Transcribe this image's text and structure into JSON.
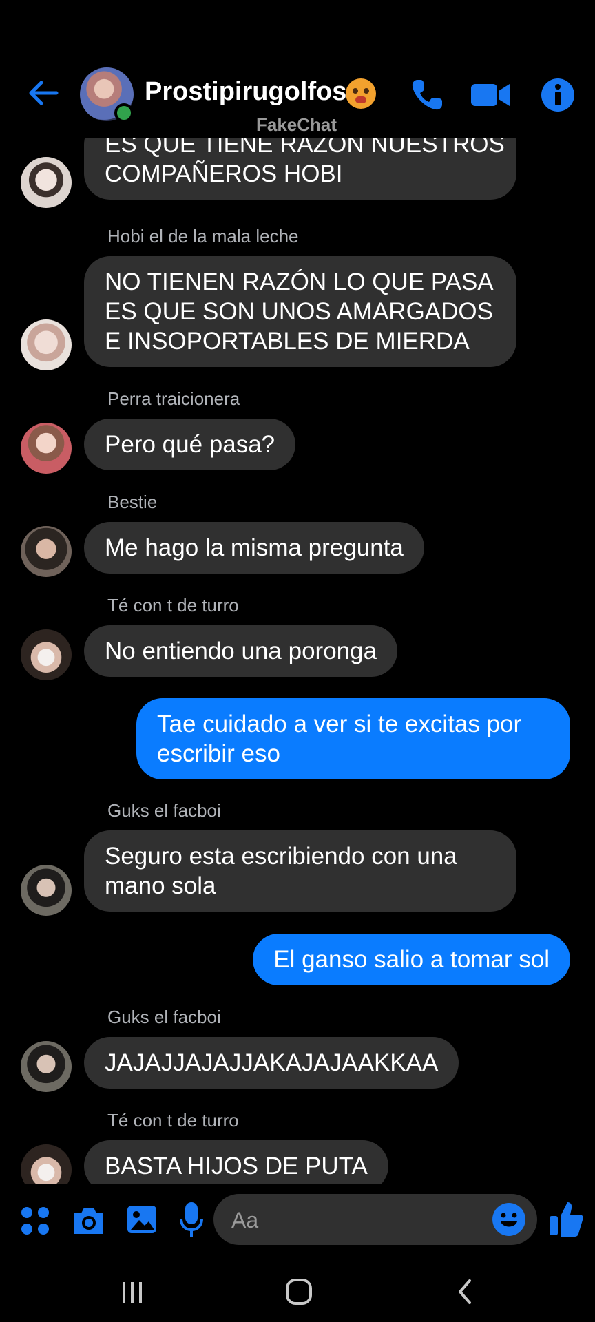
{
  "header": {
    "title": "Prostipirugolfos",
    "watermark": "FakeChat",
    "back_icon": "back-arrow-icon",
    "call_icon": "phone-icon",
    "video_icon": "video-camera-icon",
    "info_icon": "info-icon",
    "accent_color": "#1877f2"
  },
  "messages": [
    {
      "sender": "",
      "text_lines": [
        "ES QUE TIENE RAZÓN NUESTROS",
        "COMPAÑEROS HOBI"
      ],
      "mine": false
    },
    {
      "sender": "Hobi el de la mala leche",
      "text_lines": [
        "NO TIENEN RAZÓN LO QUE PASA",
        "ES QUE SON UNOS AMARGADOS",
        "E INSOPORTABLES DE MIERDA"
      ],
      "mine": false
    },
    {
      "sender": "Perra traicionera",
      "text_lines": [
        "Pero qué pasa?"
      ],
      "mine": false
    },
    {
      "sender": "Bestie",
      "text_lines": [
        "Me hago la misma pregunta"
      ],
      "mine": false
    },
    {
      "sender": "Té con t de turro",
      "text_lines": [
        "No entiendo una poronga"
      ],
      "mine": false
    },
    {
      "sender": "",
      "text_lines": [
        "Tae cuidado a ver si te excitas por",
        "escribir eso"
      ],
      "mine": true
    },
    {
      "sender": "Guks el facboi",
      "text_lines": [
        "Seguro esta escribiendo con una",
        "mano sola"
      ],
      "mine": false
    },
    {
      "sender": "",
      "text_lines": [
        "El ganso salio a tomar sol"
      ],
      "mine": true
    },
    {
      "sender": "Guks el facboi",
      "text_lines": [
        "JAJAJJAJAJJAKAJAJAAKKAA"
      ],
      "mine": false
    },
    {
      "sender": "Té con t de turro",
      "text_lines": [
        "BASTA HIJOS DE PUTA"
      ],
      "mine": false
    }
  ],
  "composer": {
    "placeholder": "Aa",
    "icons": [
      "apps-icon",
      "camera-icon",
      "gallery-icon",
      "microphone-icon",
      "emoji-icon",
      "thumbs-up-icon"
    ]
  },
  "navbar": {
    "icons": [
      "recent-apps-icon",
      "home-icon",
      "back-icon"
    ]
  }
}
